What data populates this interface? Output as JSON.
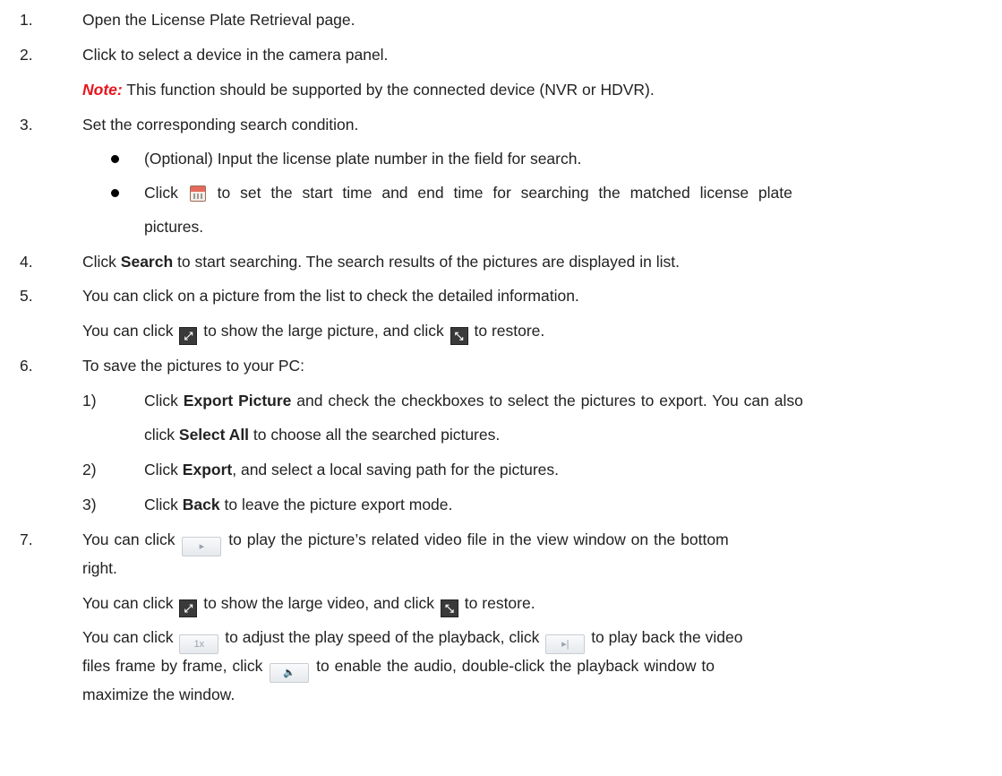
{
  "steps": {
    "s1": {
      "num": "1.",
      "text": "Open the License Plate Retrieval page."
    },
    "s2": {
      "num": "2.",
      "text": "Click to select a device in the camera panel.",
      "note_label": "Note:",
      "note_text": "This function should be supported by the connected device (NVR or HDVR)."
    },
    "s3": {
      "num": "3.",
      "text": "Set the corresponding search condition.",
      "b1": "(Optional) Input the license plate number in the field for search.",
      "b2_pre": "Click",
      "b2_post": "to set the start time and end time for searching the matched license plate",
      "b2_cont": "pictures."
    },
    "s4": {
      "num": "4.",
      "pre": "Click",
      "bold": "Search",
      "post": "to start searching. The search results of the pictures are displayed in list."
    },
    "s5": {
      "num": "5.",
      "text": "You can click on a picture from the list to check the detailed information.",
      "l2_pre": "You can click",
      "l2_mid": "to show the large picture, and click",
      "l2_post": "to restore."
    },
    "s6": {
      "num": "6.",
      "text": "To save the pictures to your PC:",
      "sub1": {
        "num": "1)",
        "pre": "Click",
        "bold": "Export Picture",
        "post": "and check the checkboxes to select the pictures to export. You can also",
        "cont_pre": "click",
        "cont_bold": "Select All",
        "cont_post": "to choose all the searched pictures."
      },
      "sub2": {
        "num": "2)",
        "pre": "Click",
        "bold": "Export",
        "post": ", and select a local saving path for the pictures."
      },
      "sub3": {
        "num": "3)",
        "pre": "Click",
        "bold": "Back",
        "post": "to leave the picture export mode."
      }
    },
    "s7": {
      "num": "7.",
      "l1_pre": "You can click",
      "l1_post": "to play the picture’s related video file in the view window on the bottom",
      "l1_cont": "right.",
      "l2_pre": "You can click",
      "l2_mid": "to show the large video, and click",
      "l2_post": "to restore.",
      "l3_pre": "You can click",
      "speed_label": "1x",
      "l3_mid": "to adjust the play speed of the playback, click",
      "l3_post": "to play back the video",
      "l4_pre": "files frame by frame, click",
      "l4_post": "to enable the audio, double-click the playback window to",
      "l5": "maximize the window."
    }
  },
  "icons": {
    "calendar": "calendar-icon",
    "fullscreen": "fullscreen-icon",
    "restore": "restore-icon",
    "play": "play-button-icon",
    "speed": "speed-button-icon",
    "frame": "frame-by-frame-icon",
    "audio": "audio-icon"
  },
  "colors": {
    "note": "#e8141c",
    "text": "#222222"
  }
}
